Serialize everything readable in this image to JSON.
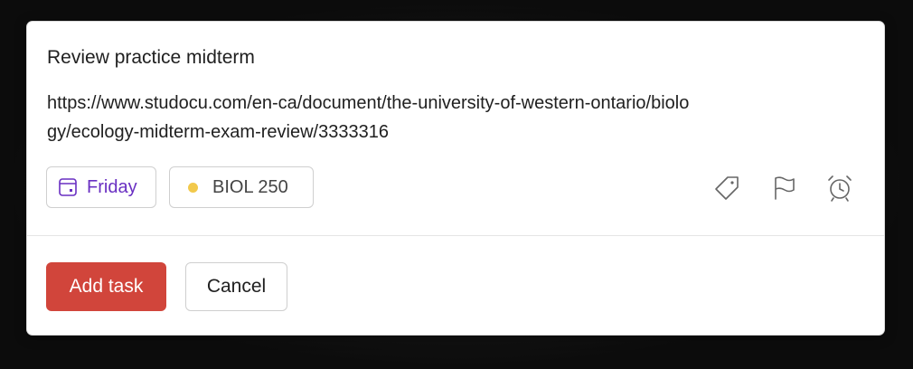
{
  "task": {
    "title": "Review practice midterm",
    "description": "https://www.studocu.com/en-ca/document/the-university-of-western-ontario/biology/ecology-midterm-exam-review/3333316"
  },
  "chips": {
    "due_date": "Friday",
    "project": "BIOL 250",
    "project_color": "#f2c94c",
    "date_color": "#692fc2"
  },
  "icons": {
    "date": "calendar-icon",
    "label": "tag-icon",
    "priority": "flag-icon",
    "reminder": "alarm-clock-icon"
  },
  "buttons": {
    "add": "Add task",
    "cancel": "Cancel",
    "add_color": "#d1453b"
  }
}
